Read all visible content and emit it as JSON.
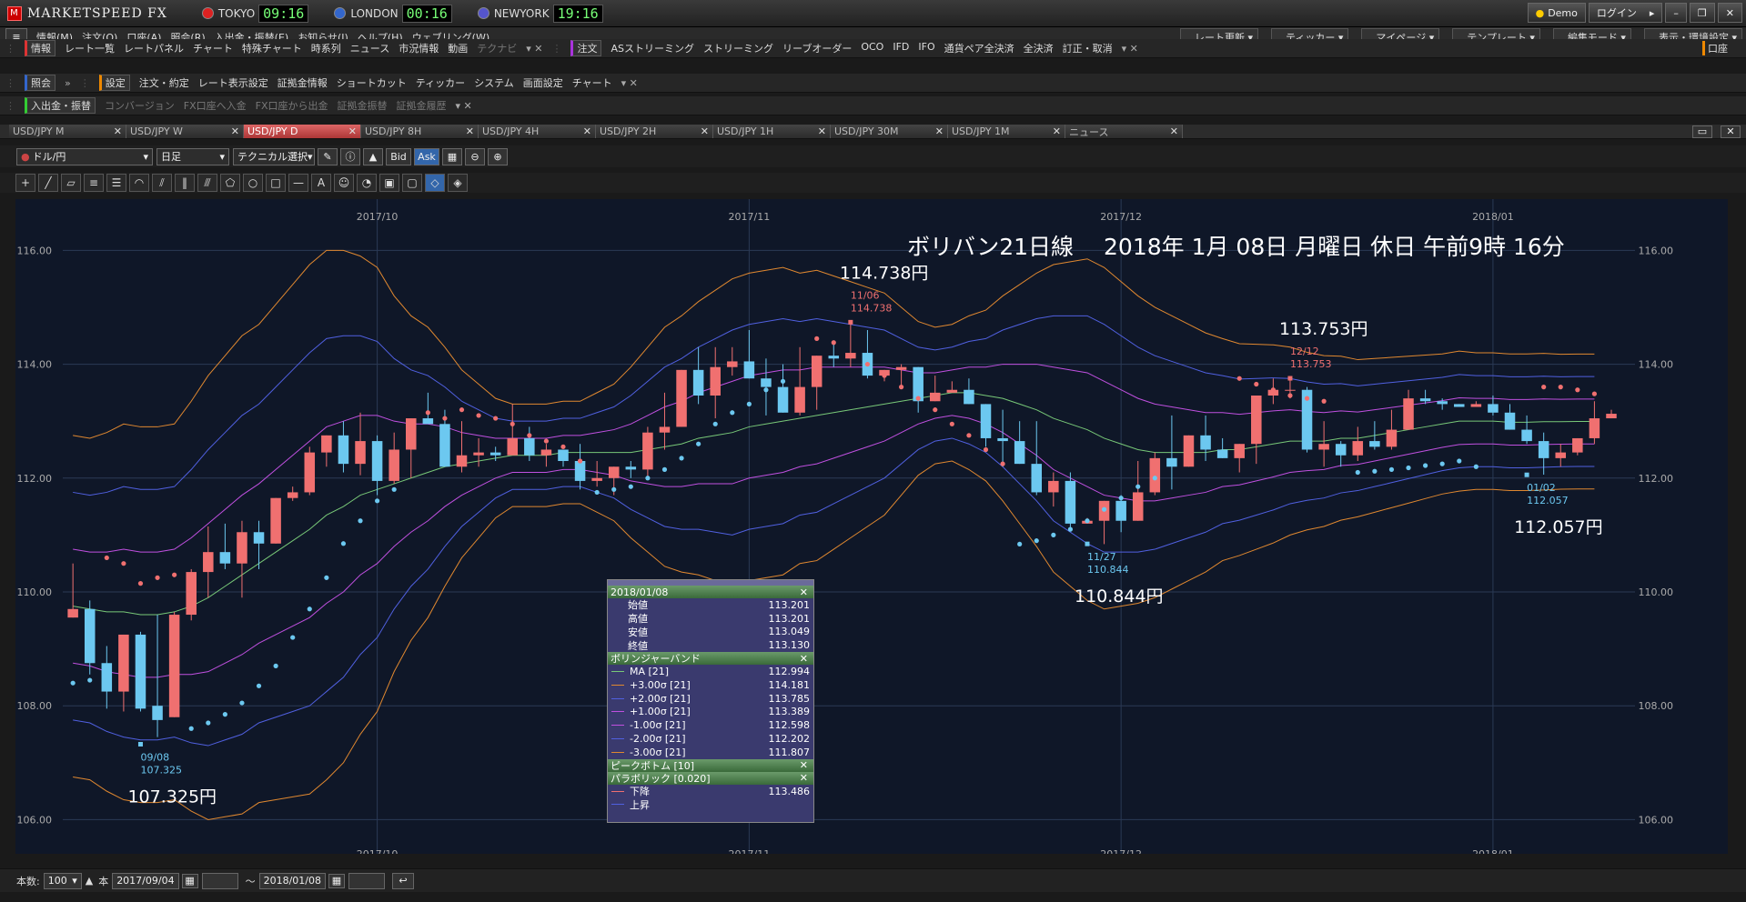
{
  "app": {
    "brand": "MARKETSPEED FX",
    "brand_mark": "M"
  },
  "clocks": [
    {
      "city": "TOKYO",
      "time": "09:16",
      "color": "#d22"
    },
    {
      "city": "LONDON",
      "time": "00:16",
      "color": "#36c"
    },
    {
      "city": "NEWYORK",
      "time": "19:16",
      "color": "#55c"
    }
  ],
  "window": {
    "demo": "Demo",
    "login": "ログイン"
  },
  "menu": [
    "情報(M)",
    "注文(O)",
    "口座(A)",
    "照会(R)",
    "入出金・振替(E)",
    "お知らせ(I)",
    "ヘルプ(H)",
    "ウェブリング(W)"
  ],
  "menu_right": [
    "レート更新",
    "ティッカー",
    "マイページ",
    "テンプレート",
    "編集モード",
    "表示・環境設定"
  ],
  "toolbar1": {
    "a": [
      "情報",
      "レート一覧",
      "レートパネル",
      "チャート",
      "特殊チャート",
      "時系列",
      "ニュース",
      "市況情報",
      "動画",
      "テクナビ"
    ],
    "b": [
      "注文",
      "ASストリーミング",
      "ストリーミング",
      "リーブオーダー",
      "OCO",
      "IFD",
      "IFO",
      "通貨ペア全決済",
      "全決済",
      "訂正・取消"
    ],
    "right": "口座"
  },
  "toolbar2": {
    "a": [
      "照会"
    ],
    "b": [
      "設定",
      "注文・約定",
      "レート表示設定",
      "証拠金情報",
      "ショートカット",
      "ティッカー",
      "システム",
      "画面設定",
      "チャート"
    ]
  },
  "toolbar3": [
    "入出金・振替",
    "コンバージョン",
    "FX口座へ入金",
    "FX口座から出金",
    "証拠金振替",
    "証拠金履歴"
  ],
  "tabs": [
    "USD/JPY M",
    "USD/JPY W",
    "USD/JPY D",
    "USD/JPY 8H",
    "USD/JPY 4H",
    "USD/JPY 2H",
    "USD/JPY 1H",
    "USD/JPY 30M",
    "USD/JPY 1M",
    "ニュース"
  ],
  "active_tab": 2,
  "controls": {
    "currency": "ドル/円",
    "period": "日足",
    "technical": "テクニカル選択",
    "bid": "Bid",
    "ask": "Ask"
  },
  "bottom": {
    "count_label": "本数:",
    "count": "100",
    "unit": "本",
    "from": "2017/09/04",
    "to": "2018/01/08",
    "tilde": "～"
  },
  "chart_data": {
    "type": "candlestick",
    "title": "ボリバン21日線　 2018年 1月 08日 月曜日 休日 午前9時 16分",
    "x_ticks": [
      {
        "label": "2017/10",
        "i": 18
      },
      {
        "label": "2017/11",
        "i": 40
      },
      {
        "label": "2017/12",
        "i": 62
      },
      {
        "label": "2018/01",
        "i": 84
      }
    ],
    "y_ticks": [
      "106.00",
      "108.00",
      "110.00",
      "112.00",
      "114.00",
      "116.00"
    ],
    "ylim": [
      105.4,
      116.9
    ],
    "candles": [
      [
        109.55,
        110.5,
        109.55,
        109.7
      ],
      [
        109.7,
        109.85,
        108.55,
        108.75
      ],
      [
        108.75,
        109.05,
        107.95,
        108.25
      ],
      [
        108.25,
        109.2,
        107.9,
        109.25
      ],
      [
        109.25,
        109.3,
        107.9,
        107.95
      ],
      [
        108.0,
        109.6,
        107.45,
        107.75
      ],
      [
        107.8,
        109.65,
        107.8,
        109.6
      ],
      [
        109.6,
        110.4,
        109.5,
        110.35
      ],
      [
        110.35,
        111.15,
        109.9,
        110.7
      ],
      [
        110.7,
        111.2,
        110.4,
        110.5
      ],
      [
        110.5,
        111.25,
        109.9,
        111.05
      ],
      [
        111.05,
        111.25,
        110.4,
        110.85
      ],
      [
        110.85,
        111.6,
        110.85,
        111.65
      ],
      [
        111.65,
        111.85,
        111.6,
        111.75
      ],
      [
        111.75,
        112.55,
        111.7,
        112.45
      ],
      [
        112.45,
        112.75,
        112.2,
        112.75
      ],
      [
        112.75,
        113.0,
        112.1,
        112.25
      ],
      [
        112.25,
        113.15,
        112.05,
        112.65
      ],
      [
        112.65,
        112.75,
        111.7,
        111.95
      ],
      [
        111.95,
        112.8,
        111.9,
        112.5
      ],
      [
        112.5,
        113.0,
        112.0,
        113.05
      ],
      [
        113.05,
        113.5,
        112.95,
        112.95
      ],
      [
        112.95,
        113.2,
        112.3,
        112.2
      ],
      [
        112.2,
        113.0,
        112.1,
        112.4
      ],
      [
        112.4,
        112.7,
        112.2,
        112.45
      ],
      [
        112.45,
        112.55,
        112.3,
        112.4
      ],
      [
        112.4,
        113.3,
        112.5,
        112.7
      ],
      [
        112.7,
        112.9,
        112.3,
        112.4
      ],
      [
        112.4,
        112.6,
        112.2,
        112.5
      ],
      [
        112.5,
        112.5,
        112.2,
        112.3
      ],
      [
        112.3,
        112.6,
        111.8,
        111.95
      ],
      [
        111.95,
        112.3,
        111.85,
        112.0
      ],
      [
        112.0,
        112.1,
        111.7,
        112.2
      ],
      [
        112.2,
        112.3,
        112.0,
        112.15
      ],
      [
        112.15,
        112.9,
        112.0,
        112.8
      ],
      [
        112.8,
        113.5,
        112.5,
        112.9
      ],
      [
        112.9,
        113.9,
        112.9,
        113.9
      ],
      [
        113.9,
        114.3,
        113.3,
        113.45
      ],
      [
        113.45,
        114.3,
        113.05,
        113.95
      ],
      [
        113.95,
        114.3,
        113.8,
        114.05
      ],
      [
        114.05,
        114.6,
        114.0,
        113.75
      ],
      [
        113.75,
        114.1,
        113.1,
        113.6
      ],
      [
        113.6,
        114.0,
        113.3,
        113.15
      ],
      [
        113.15,
        114.3,
        113.1,
        113.6
      ],
      [
        113.6,
        114.1,
        113.2,
        114.15
      ],
      [
        114.15,
        114.4,
        113.95,
        114.1
      ],
      [
        114.1,
        114.74,
        113.95,
        114.2
      ],
      [
        114.2,
        114.6,
        113.75,
        113.8
      ],
      [
        113.8,
        113.75,
        113.7,
        113.9
      ],
      [
        113.9,
        114.0,
        113.6,
        113.95
      ],
      [
        113.95,
        113.95,
        113.15,
        113.35
      ],
      [
        113.35,
        113.8,
        113.35,
        113.5
      ],
      [
        113.5,
        113.7,
        113.5,
        113.55
      ],
      [
        113.55,
        113.75,
        113.3,
        113.3
      ],
      [
        113.3,
        113.3,
        112.55,
        112.7
      ],
      [
        112.7,
        113.2,
        112.2,
        112.65
      ],
      [
        112.65,
        113.0,
        112.3,
        112.25
      ],
      [
        112.25,
        113.0,
        111.7,
        111.75
      ],
      [
        111.75,
        112.1,
        111.5,
        111.95
      ],
      [
        111.95,
        112.1,
        111.1,
        111.2
      ],
      [
        111.2,
        111.3,
        111.2,
        111.25
      ],
      [
        111.25,
        111.55,
        110.84,
        111.6
      ],
      [
        111.6,
        111.7,
        111.05,
        111.25
      ],
      [
        111.25,
        112.3,
        111.5,
        111.75
      ],
      [
        111.75,
        112.45,
        111.7,
        112.35
      ],
      [
        112.35,
        113.1,
        111.8,
        112.2
      ],
      [
        112.2,
        112.75,
        112.2,
        112.75
      ],
      [
        112.75,
        113.1,
        112.3,
        112.5
      ],
      [
        112.5,
        112.7,
        112.4,
        112.35
      ],
      [
        112.35,
        112.55,
        112.1,
        112.6
      ],
      [
        112.6,
        113.45,
        112.25,
        113.45
      ],
      [
        113.45,
        113.75,
        113.3,
        113.55
      ],
      [
        113.55,
        113.75,
        113.4,
        113.55
      ],
      [
        113.55,
        113.6,
        112.45,
        112.5
      ],
      [
        112.5,
        113.0,
        112.2,
        112.6
      ],
      [
        112.6,
        112.65,
        112.2,
        112.4
      ],
      [
        112.4,
        112.9,
        112.3,
        112.65
      ],
      [
        112.65,
        113.0,
        112.5,
        112.55
      ],
      [
        112.55,
        113.2,
        112.5,
        112.85
      ],
      [
        112.85,
        113.55,
        112.95,
        113.4
      ],
      [
        113.4,
        113.55,
        113.3,
        113.35
      ],
      [
        113.35,
        113.4,
        113.2,
        113.3
      ],
      [
        113.3,
        113.3,
        113.25,
        113.25
      ],
      [
        113.25,
        113.35,
        113.25,
        113.3
      ],
      [
        113.3,
        113.45,
        113.1,
        113.15
      ],
      [
        113.15,
        113.3,
        112.95,
        112.85
      ],
      [
        112.85,
        113.1,
        112.6,
        112.65
      ],
      [
        112.65,
        112.8,
        112.06,
        112.35
      ],
      [
        112.35,
        112.6,
        112.2,
        112.45
      ],
      [
        112.45,
        112.65,
        112.4,
        112.7
      ],
      [
        112.7,
        113.35,
        112.6,
        113.05
      ],
      [
        113.05,
        113.2,
        113.05,
        113.13
      ]
    ],
    "bands": {
      "ma": [
        109.75,
        109.7,
        109.65,
        109.65,
        109.6,
        109.6,
        109.65,
        109.75,
        109.9,
        110.1,
        110.3,
        110.5,
        110.7,
        110.9,
        111.1,
        111.35,
        111.5,
        111.7,
        111.8,
        111.9,
        112.0,
        112.1,
        112.2,
        112.25,
        112.3,
        112.35,
        112.4,
        112.4,
        112.4,
        112.45,
        112.45,
        112.45,
        112.45,
        112.45,
        112.5,
        112.55,
        112.6,
        112.7,
        112.75,
        112.8,
        112.9,
        112.95,
        113.0,
        113.05,
        113.1,
        113.15,
        113.2,
        113.25,
        113.3,
        113.35,
        113.4,
        113.45,
        113.5,
        113.5,
        113.45,
        113.4,
        113.3,
        113.2,
        113.05,
        112.95,
        112.85,
        112.7,
        112.6,
        112.5,
        112.45,
        112.45,
        112.45,
        112.45,
        112.5,
        112.5,
        112.55,
        112.6,
        112.65,
        112.65,
        112.65,
        112.7,
        112.7,
        112.75,
        112.8,
        112.85,
        112.9,
        112.95,
        113.0,
        113.0,
        113.0,
        112.98,
        112.98,
        112.99,
        112.99,
        112.994,
        112.994
      ],
      "s1": [
        1.0,
        1.0,
        1.05,
        1.1,
        1.1,
        1.1,
        1.1,
        1.2,
        1.3,
        1.35,
        1.4,
        1.4,
        1.45,
        1.5,
        1.55,
        1.55,
        1.5,
        1.4,
        1.3,
        1.1,
        0.95,
        0.85,
        0.7,
        0.55,
        0.45,
        0.35,
        0.3,
        0.3,
        0.3,
        0.3,
        0.3,
        0.35,
        0.4,
        0.5,
        0.6,
        0.7,
        0.75,
        0.8,
        0.85,
        0.9,
        0.9,
        0.9,
        0.9,
        0.85,
        0.85,
        0.8,
        0.75,
        0.7,
        0.65,
        0.55,
        0.45,
        0.4,
        0.4,
        0.45,
        0.5,
        0.6,
        0.7,
        0.8,
        0.9,
        0.95,
        1.0,
        1.0,
        0.95,
        0.9,
        0.85,
        0.8,
        0.75,
        0.7,
        0.65,
        0.62,
        0.6,
        0.58,
        0.55,
        0.52,
        0.5,
        0.48,
        0.46,
        0.45,
        0.44,
        0.43,
        0.42,
        0.41,
        0.41,
        0.4,
        0.4,
        0.4,
        0.4,
        0.4,
        0.395,
        0.395,
        0.395
      ]
    },
    "psar": {
      "dn": [
        [
          2,
          110.6
        ],
        [
          3,
          110.5
        ],
        [
          4,
          110.15
        ],
        [
          5,
          110.25
        ],
        [
          6,
          110.3
        ],
        [
          20,
          112.95
        ],
        [
          21,
          113.15
        ],
        [
          22,
          113.05
        ],
        [
          23,
          113.2
        ],
        [
          24,
          113.1
        ],
        [
          25,
          113.05
        ],
        [
          26,
          112.95
        ],
        [
          27,
          112.75
        ],
        [
          28,
          112.65
        ],
        [
          29,
          112.55
        ],
        [
          30,
          112.3
        ],
        [
          44,
          114.45
        ],
        [
          45,
          114.38
        ],
        [
          46,
          114.15
        ],
        [
          47,
          114.0
        ],
        [
          48,
          113.8
        ],
        [
          49,
          113.6
        ],
        [
          50,
          113.4
        ],
        [
          51,
          113.2
        ],
        [
          52,
          112.95
        ],
        [
          53,
          112.75
        ],
        [
          54,
          112.5
        ],
        [
          55,
          112.25
        ],
        [
          69,
          113.75
        ],
        [
          70,
          113.65
        ],
        [
          71,
          113.55
        ],
        [
          72,
          113.45
        ],
        [
          73,
          113.4
        ],
        [
          74,
          113.35
        ],
        [
          87,
          113.6
        ],
        [
          88,
          113.6
        ],
        [
          89,
          113.55
        ],
        [
          90,
          113.48
        ]
      ],
      "up": [
        [
          0,
          108.4
        ],
        [
          1,
          108.45
        ],
        [
          2,
          108.5
        ],
        [
          7,
          107.6
        ],
        [
          8,
          107.7
        ],
        [
          9,
          107.85
        ],
        [
          10,
          108.05
        ],
        [
          11,
          108.35
        ],
        [
          12,
          108.7
        ],
        [
          13,
          109.2
        ],
        [
          14,
          109.7
        ],
        [
          15,
          110.25
        ],
        [
          16,
          110.85
        ],
        [
          17,
          111.25
        ],
        [
          18,
          111.6
        ],
        [
          19,
          111.8
        ],
        [
          31,
          111.75
        ],
        [
          32,
          111.8
        ],
        [
          33,
          111.85
        ],
        [
          34,
          112.0
        ],
        [
          35,
          112.15
        ],
        [
          36,
          112.35
        ],
        [
          37,
          112.6
        ],
        [
          38,
          112.95
        ],
        [
          39,
          113.15
        ],
        [
          40,
          113.3
        ],
        [
          41,
          113.55
        ],
        [
          42,
          113.7
        ],
        [
          56,
          110.84
        ],
        [
          57,
          110.9
        ],
        [
          58,
          111.0
        ],
        [
          59,
          111.1
        ],
        [
          60,
          111.25
        ],
        [
          61,
          111.45
        ],
        [
          62,
          111.65
        ],
        [
          63,
          111.85
        ],
        [
          64,
          112.0
        ],
        [
          76,
          112.1
        ],
        [
          77,
          112.12
        ],
        [
          78,
          112.15
        ],
        [
          79,
          112.18
        ],
        [
          80,
          112.22
        ],
        [
          81,
          112.25
        ],
        [
          82,
          112.3
        ],
        [
          83,
          112.2
        ]
      ]
    },
    "peaks": [
      {
        "i": 4,
        "date": "09/08",
        "val": "107.325",
        "big": "107.325円",
        "pos": "low"
      },
      {
        "i": 46,
        "date": "11/06",
        "val": "114.738",
        "big": "114.738円",
        "pos": "high"
      },
      {
        "i": 60,
        "date": "11/27",
        "val": "110.844",
        "big": "110.844円",
        "pos": "low"
      },
      {
        "i": 72,
        "date": "12/12",
        "val": "113.753",
        "big": "113.753円",
        "pos": "high"
      },
      {
        "i": 86,
        "date": "01/02",
        "val": "112.057",
        "big": "112.057円",
        "pos": "low"
      }
    ],
    "colors": {
      "up": "#f07070",
      "down": "#6cc8f0",
      "ma": "#78c878",
      "s1": "#c050e0",
      "s2": "#5060e0",
      "s3": "#e08830",
      "bg": "#0f1728"
    }
  },
  "panel": {
    "date": "2018/01/08",
    "ohlc": [
      [
        "始値",
        "113.201"
      ],
      [
        "高値",
        "113.201"
      ],
      [
        "安値",
        "113.049"
      ],
      [
        "終値",
        "113.130"
      ]
    ],
    "bb_title": "ボリンジャーバンド",
    "bb": [
      [
        "MA [21]",
        "112.994",
        "#78c878"
      ],
      [
        "+3.00σ [21]",
        "114.181",
        "#e08830"
      ],
      [
        "+2.00σ [21]",
        "113.785",
        "#5060e0"
      ],
      [
        "+1.00σ [21]",
        "113.389",
        "#c050e0"
      ],
      [
        "-1.00σ [21]",
        "112.598",
        "#c050e0"
      ],
      [
        "-2.00σ [21]",
        "112.202",
        "#5060e0"
      ],
      [
        "-3.00σ [21]",
        "111.807",
        "#e08830"
      ]
    ],
    "pb_title": "ピークボトム [10]",
    "ps_title": "パラボリック [0.020]",
    "ps": [
      [
        "下降",
        "113.486",
        "#f07070"
      ],
      [
        "上昇",
        "",
        "#5060e0"
      ]
    ]
  }
}
